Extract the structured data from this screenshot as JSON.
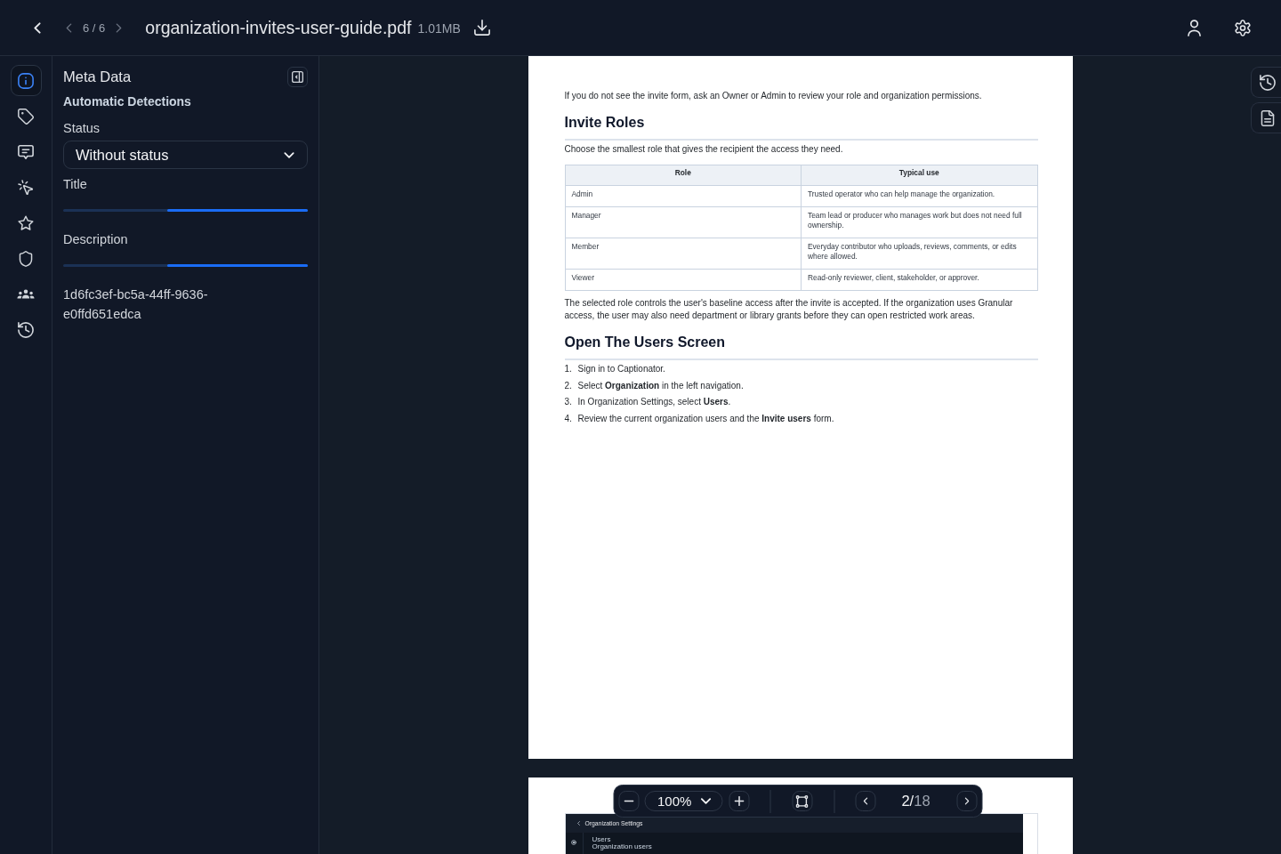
{
  "header": {
    "pager": "6 / 6",
    "file_name": "organization-invites-user-guide.pdf",
    "file_size": "1.01MB"
  },
  "rail": [
    {
      "kind": "info",
      "selected": true
    },
    {
      "kind": "tag",
      "selected": false
    },
    {
      "kind": "comment",
      "selected": false
    },
    {
      "kind": "click",
      "selected": false
    },
    {
      "kind": "star",
      "selected": false
    },
    {
      "kind": "shield",
      "selected": false
    },
    {
      "kind": "users",
      "selected": false
    },
    {
      "kind": "history",
      "selected": false
    }
  ],
  "meta": {
    "title": "Meta Data",
    "subtitle": "Automatic Detections",
    "fields": [
      {
        "kind": "select",
        "label": "Status",
        "value": "Without status"
      },
      {
        "kind": "loading",
        "label": "Title"
      },
      {
        "kind": "loading",
        "label": "Description"
      },
      {
        "kind": "text",
        "value": "1d6fc3ef-bc5a-44ff-9636-e0ffd651edca"
      }
    ]
  },
  "side_tools": [
    {
      "kind": "history"
    },
    {
      "kind": "document"
    }
  ],
  "pages": [
    {
      "blocks": [
        {
          "kind": "paragraph",
          "text": "If you do not see the invite form, ask an Owner or Admin to review your role and organization permissions."
        },
        {
          "kind": "heading",
          "text": "Invite Roles"
        },
        {
          "kind": "paragraph",
          "text": "Choose the smallest role that gives the recipient the access they need."
        },
        {
          "kind": "table",
          "columns": [
            "Role",
            "Typical use"
          ],
          "rows": [
            [
              "Admin",
              "Trusted operator who can help manage the organization."
            ],
            [
              "Manager",
              "Team lead or producer who manages work but does not need full ownership."
            ],
            [
              "Member",
              "Everyday contributor who uploads, reviews, comments, or edits where allowed."
            ],
            [
              "Viewer",
              "Read-only reviewer, client, stakeholder, or approver."
            ]
          ]
        },
        {
          "kind": "paragraph",
          "text": "The selected role controls the user's baseline access after the invite is accepted. If the organization uses Granular access, the user may also need department or library grants before they can open restricted work areas."
        },
        {
          "kind": "heading",
          "text": "Open The Users Screen"
        },
        {
          "kind": "list",
          "items": [
            {
              "number": "1.",
              "text": "Sign in to Captionator."
            },
            {
              "number": "2.",
              "text": "Select **Organization** in the left navigation."
            },
            {
              "number": "3.",
              "text": "In Organization Settings, select **Users**."
            },
            {
              "number": "4.",
              "text": "Review the current organization users and the **Invite users** form."
            }
          ]
        }
      ]
    },
    {
      "blocks": [
        {
          "kind": "screenshot",
          "title": "Organization Settings",
          "items": [
            "Users",
            "Organization users"
          ]
        }
      ]
    }
  ],
  "toolbar": {
    "zoom": "100%",
    "page_current": "2",
    "page_separator": "/",
    "page_total": "18"
  }
}
